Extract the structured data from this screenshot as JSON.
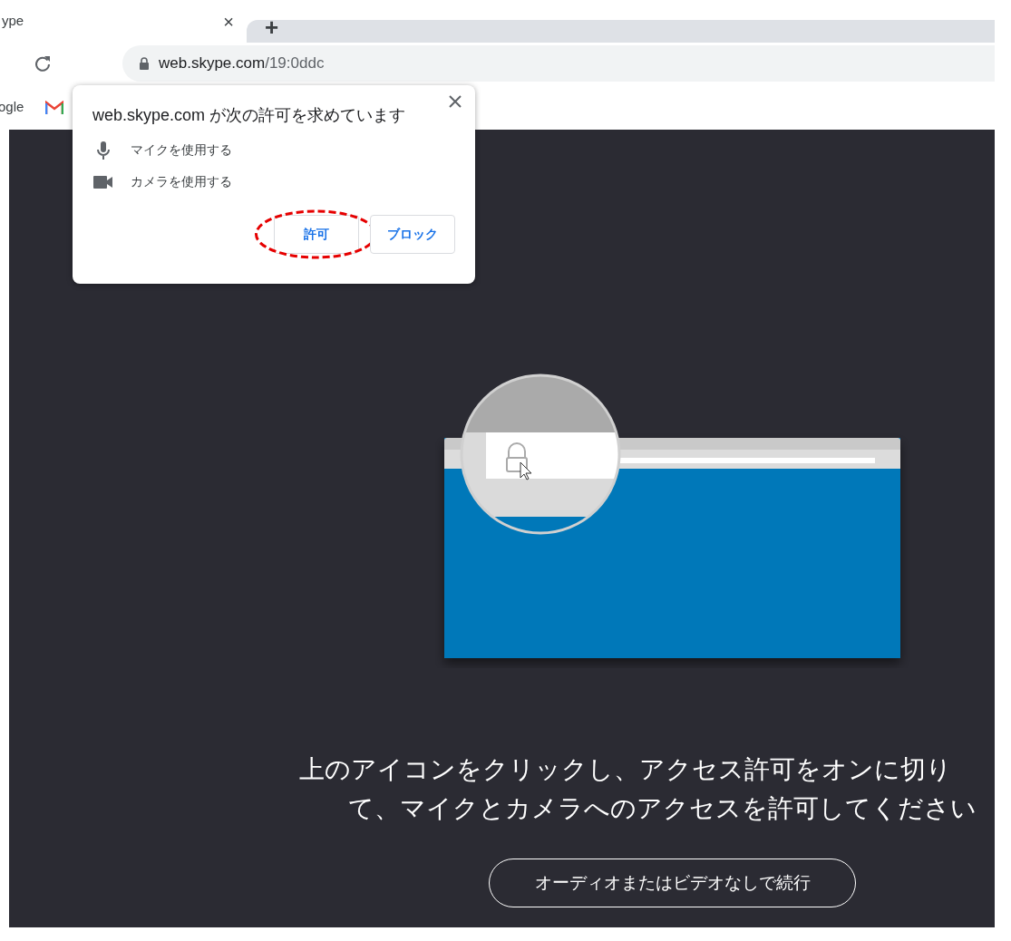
{
  "browser": {
    "tab": {
      "title": "ype",
      "close_glyph": "×"
    },
    "new_tab_glyph": "+",
    "address_bar": {
      "host": "web.skype.com",
      "path": "/19:0ddc"
    },
    "bookmarks": [
      {
        "kind": "text",
        "label": "ogle"
      },
      {
        "kind": "mail"
      }
    ]
  },
  "permission_prompt": {
    "title": "web.skype.com が次の許可を求めています",
    "permissions": [
      {
        "kind": "microphone",
        "label": "マイクを使用する"
      },
      {
        "kind": "camera",
        "label": "カメラを使用する"
      }
    ],
    "buttons": [
      {
        "label": "許可",
        "highlighted": true
      },
      {
        "label": "ブロック",
        "highlighted": false
      }
    ]
  },
  "page": {
    "message_lines": [
      "上のアイコンをクリックし、アクセス許可をオンに切り",
      "て、マイクとカメラへのアクセスを許可してください"
    ],
    "continue_button": "オーディオまたはビデオなしで続行"
  }
}
